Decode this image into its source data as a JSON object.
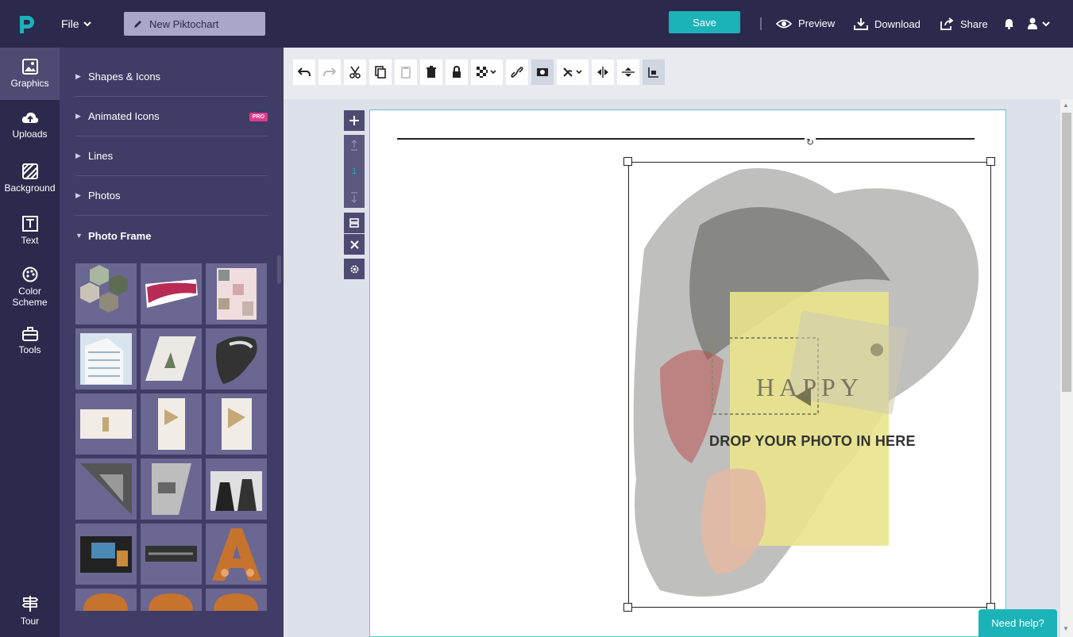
{
  "topbar": {
    "file_label": "File",
    "doc_title": "New Piktochart",
    "save_label": "Save",
    "preview_label": "Preview",
    "download_label": "Download",
    "share_label": "Share",
    "accent": "#1bb3b8"
  },
  "rail": {
    "items": [
      {
        "label": "Graphics",
        "icon": "image-icon"
      },
      {
        "label": "Uploads",
        "icon": "cloud-upload-icon"
      },
      {
        "label": "Background",
        "icon": "background-pattern-icon"
      },
      {
        "label": "Text",
        "icon": "text-icon"
      },
      {
        "label": "Color Scheme",
        "icon": "palette-icon"
      },
      {
        "label": "Tools",
        "icon": "toolbox-icon"
      },
      {
        "label": "Tour",
        "icon": "signpost-icon"
      }
    ]
  },
  "panel": {
    "sections": [
      {
        "label": "Shapes & Icons"
      },
      {
        "label": "Animated Icons",
        "badge": "PRO"
      },
      {
        "label": "Lines"
      },
      {
        "label": "Photos"
      },
      {
        "label": "Photo Frame"
      }
    ]
  },
  "canvas": {
    "page_number": "1",
    "drop_text": "DROP YOUR PHOTO IN HERE",
    "book_text": "HAPPY"
  },
  "help_label": "Need help?"
}
